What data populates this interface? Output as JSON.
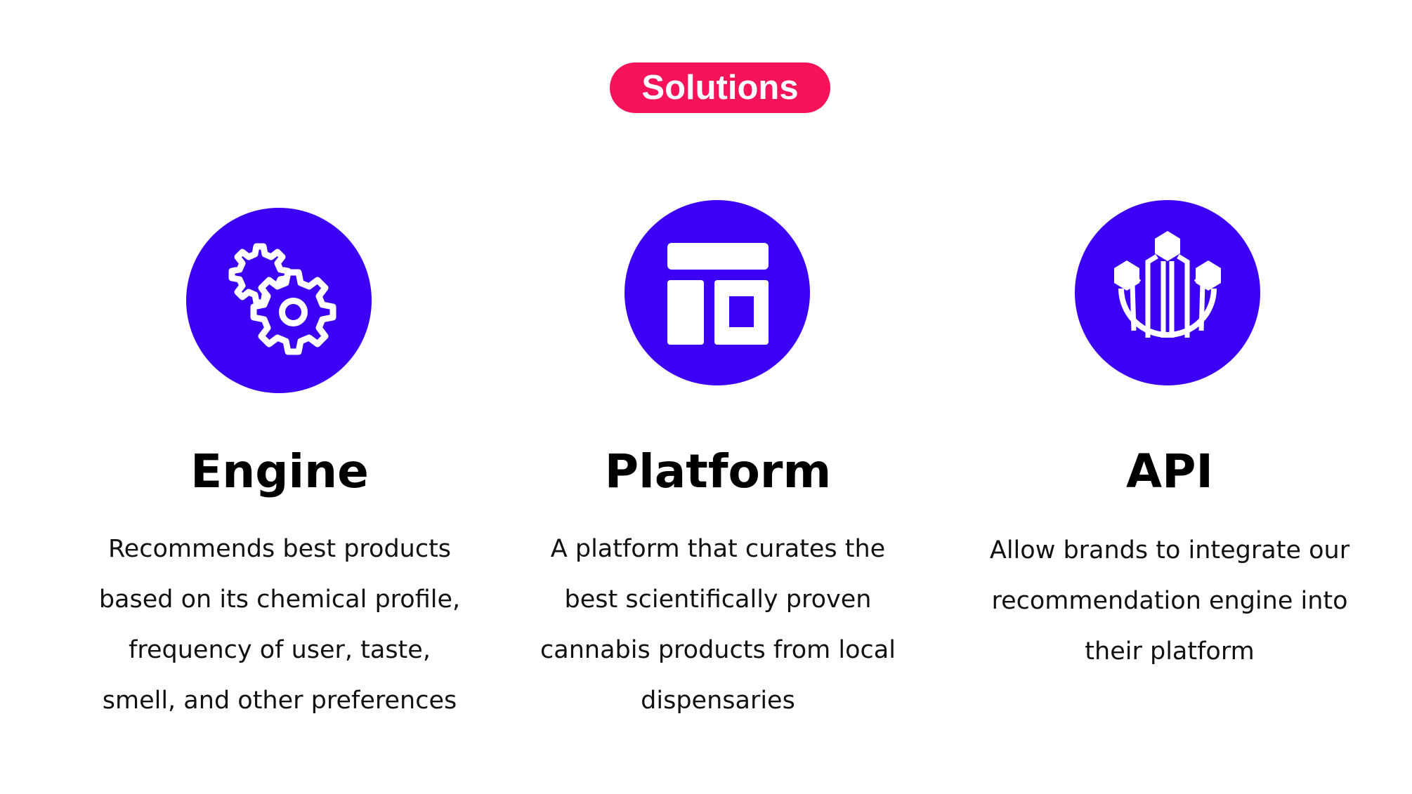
{
  "badge": {
    "label": "Solutions",
    "color": "#f7135a"
  },
  "accent_color": "#3c00f5",
  "solutions": [
    {
      "icon": "gears-icon",
      "title": "Engine",
      "description_lines": [
        "Recommends best products",
        "based on its chemical profile,",
        "frequency of user, taste,",
        "smell, and other preferences"
      ]
    },
    {
      "icon": "layout-icon",
      "title": "Platform",
      "description_lines": [
        "A platform that curates the",
        "best scientifically proven",
        "cannabis products from local",
        "dispensaries"
      ]
    },
    {
      "icon": "network-hexagon-icon",
      "title": "API",
      "description_lines": [
        "Allow brands to integrate our",
        "recommendation engine into",
        "their platform"
      ]
    }
  ]
}
